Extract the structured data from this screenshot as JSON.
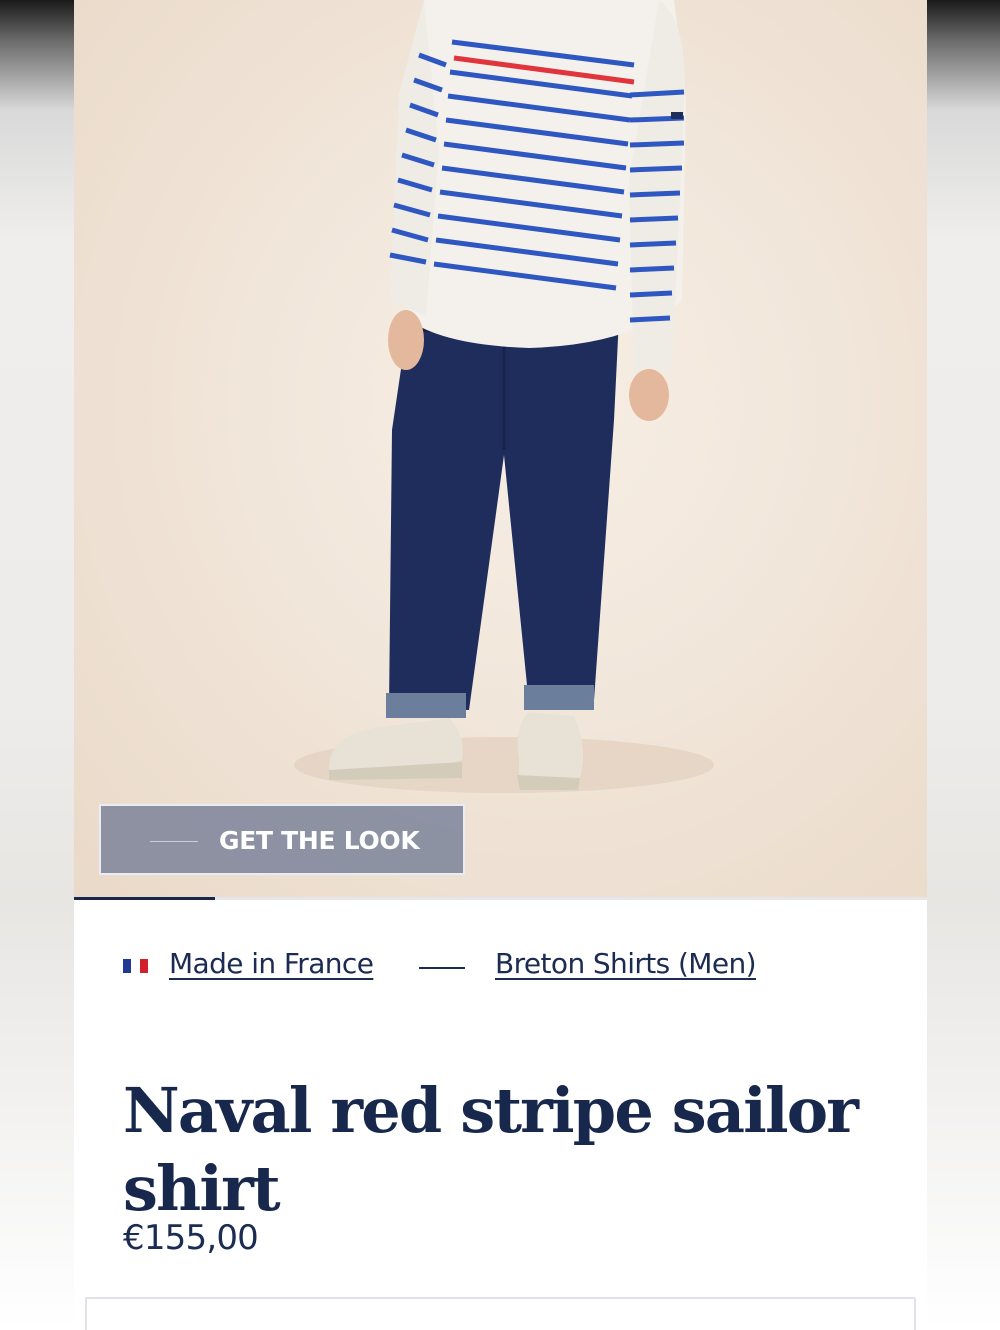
{
  "colors": {
    "navy": "#17284c",
    "hero_background": "#f1e6da",
    "get_the_look_background": "#778099",
    "flag_blue": "#1f3a93",
    "flag_white": "#ffffff",
    "flag_red": "#d21f2b"
  },
  "hero": {
    "image_description_icon": "product-photo",
    "get_the_look_label": "GET THE LOOK",
    "gallery_progress": 0.165
  },
  "breadcrumb": {
    "flag_icon": "french-flag-icon",
    "made_in_label": "Made in France",
    "category_label": "Breton Shirts (Men)"
  },
  "product": {
    "title": "Naval red stripe sailor shirt",
    "price": "€155,00"
  }
}
